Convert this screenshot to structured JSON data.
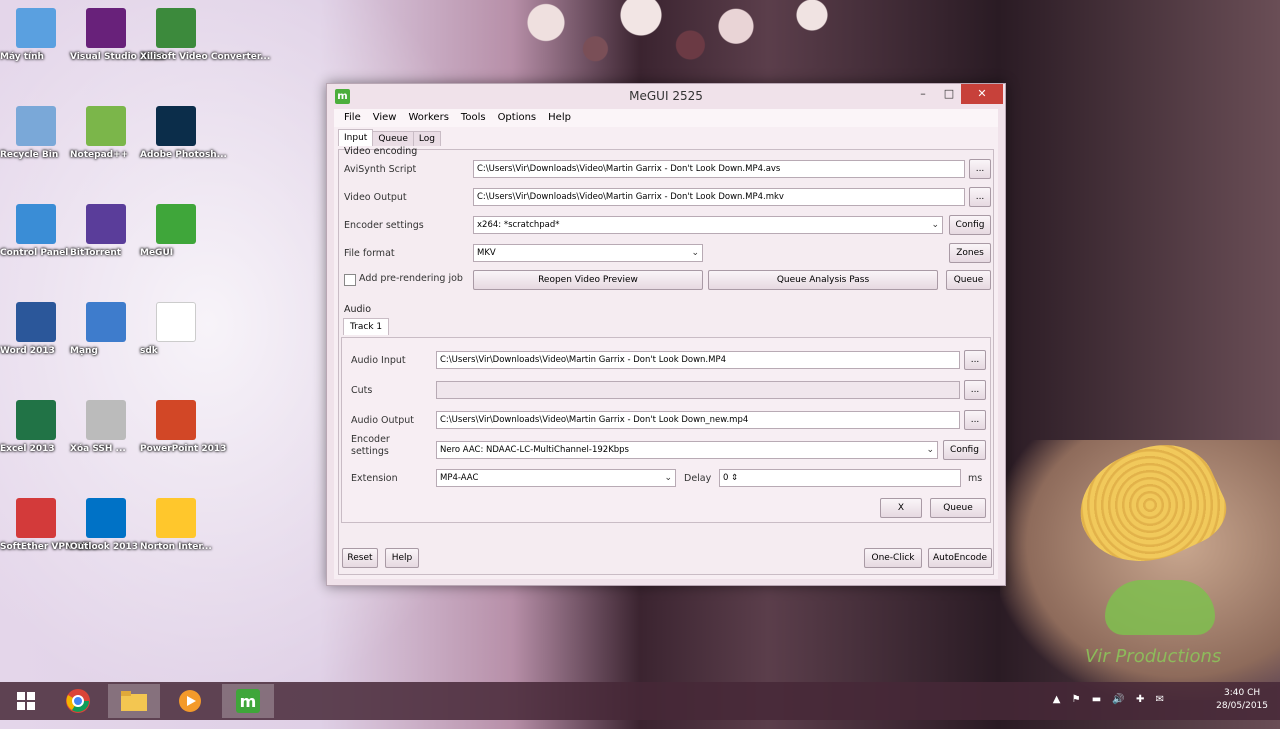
{
  "desktop": {
    "icons": [
      {
        "label": "Máy tính",
        "icon": "computer-icon",
        "color": "#5aa0e0"
      },
      {
        "label": "Visual Studio 2013",
        "icon": "visual-studio-icon",
        "color": "#68217a"
      },
      {
        "label": "Xilisoft Video Converter...",
        "icon": "video-converter-icon",
        "color": "#3c8a3c"
      },
      {
        "label": "Recycle Bin",
        "icon": "recycle-bin-icon",
        "color": "#7aa8d8"
      },
      {
        "label": "Notepad++",
        "icon": "notepad-plus-icon",
        "color": "#7bb64a"
      },
      {
        "label": "Adobe Photosh...",
        "icon": "photoshop-icon",
        "color": "#0b2d4a"
      },
      {
        "label": "Control Panel",
        "icon": "control-panel-icon",
        "color": "#3a8dd6"
      },
      {
        "label": "BitTorrent",
        "icon": "bittorrent-icon",
        "color": "#5a3d9a"
      },
      {
        "label": "MeGUI",
        "icon": "megui-icon",
        "color": "#3fa63a"
      },
      {
        "label": "Word 2013",
        "icon": "word-icon",
        "color": "#2b579a"
      },
      {
        "label": "Mạng",
        "icon": "network-icon",
        "color": "#3e7ccc"
      },
      {
        "label": "sdk",
        "icon": "file-icon",
        "color": "#ffffff"
      },
      {
        "label": "Excel 2013",
        "icon": "excel-icon",
        "color": "#217346"
      },
      {
        "label": "Xóa SSH ...",
        "icon": "tool-icon",
        "color": "#bbbbbb"
      },
      {
        "label": "PowerPoint 2013",
        "icon": "powerpoint-icon",
        "color": "#d24726"
      },
      {
        "label": "SoftEther VPN Cli...",
        "icon": "vpn-icon",
        "color": "#d33a3a"
      },
      {
        "label": "Outlook 2013",
        "icon": "outlook-icon",
        "color": "#0072c6"
      },
      {
        "label": "Norton Inter...",
        "icon": "norton-icon",
        "color": "#ffc72c"
      }
    ],
    "watermark": "Vir Productions"
  },
  "window": {
    "title": "MeGUI 2525",
    "minimize": "–",
    "maximize": "□",
    "close": "✕",
    "menu": [
      "File",
      "View",
      "Workers",
      "Tools",
      "Options",
      "Help"
    ],
    "tabs": [
      "Input",
      "Queue",
      "Log"
    ],
    "video": {
      "group_title": "Video encoding",
      "avisynth_label": "AviSynth Script",
      "avisynth_value": "C:\\Users\\Vir\\Downloads\\Video\\Martin Garrix - Don't Look Down.MP4.avs",
      "output_label": "Video Output",
      "output_value": "C:\\Users\\Vir\\Downloads\\Video\\Martin Garrix - Don't Look Down.MP4.mkv",
      "encoder_label": "Encoder settings",
      "encoder_value": "x264: *scratchpad*",
      "config": "Config",
      "format_label": "File format",
      "format_value": "MKV",
      "zones": "Zones",
      "prerender_label": "Add pre-rendering job",
      "reopen": "Reopen Video Preview",
      "queue_analysis": "Queue Analysis Pass",
      "queue": "Queue",
      "browse": "..."
    },
    "audio": {
      "group_title": "Audio",
      "track_tab": "Track 1",
      "input_label": "Audio Input",
      "input_value": "C:\\Users\\Vir\\Downloads\\Video\\Martin Garrix - Don't Look Down.MP4",
      "cuts_label": "Cuts",
      "cuts_value": "",
      "output_label": "Audio Output",
      "output_value": "C:\\Users\\Vir\\Downloads\\Video\\Martin Garrix - Don't Look Down_new.mp4",
      "encoder_label": "Encoder settings",
      "encoder_value": "Nero AAC: NDAAC-LC-MultiChannel-192Kbps",
      "config": "Config",
      "extension_label": "Extension",
      "extension_value": "MP4-AAC",
      "delay_label": "Delay",
      "delay_value": "0",
      "delay_unit": "ms",
      "x": "X",
      "queue": "Queue",
      "browse": "..."
    },
    "bottom": {
      "reset": "Reset",
      "help": "Help",
      "oneclick": "One-Click",
      "autoencode": "AutoEncode"
    }
  },
  "taskbar": {
    "tray_icons": "▲ ⚑ ▬ 🔊 ✚ ✉",
    "time": "3:40 CH",
    "date": "28/05/2015"
  }
}
